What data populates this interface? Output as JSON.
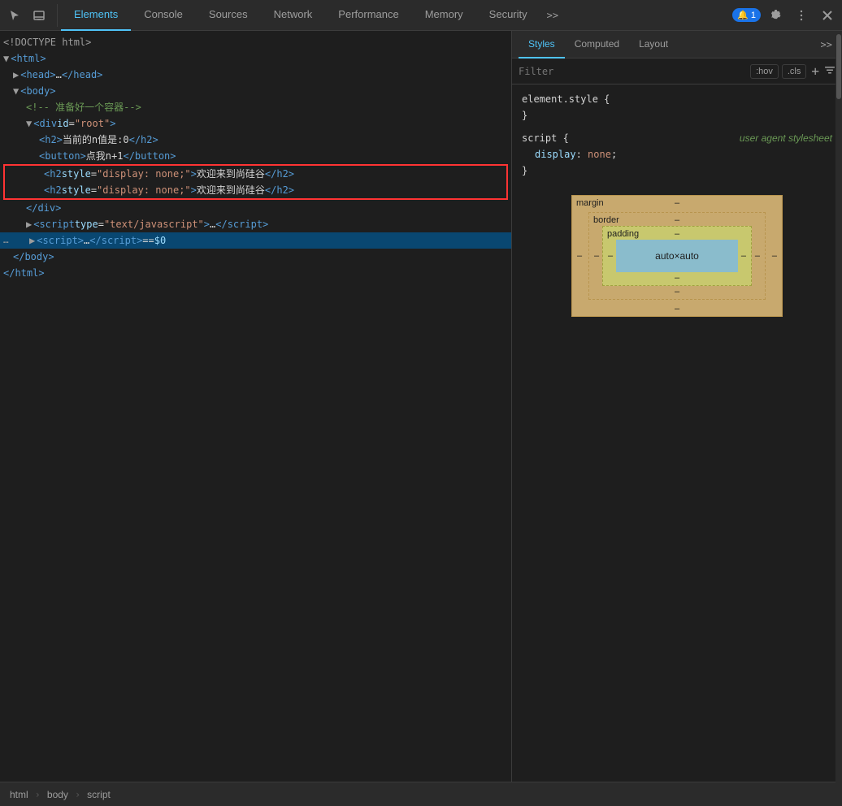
{
  "toolbar": {
    "icons": [
      {
        "name": "cursor-icon",
        "symbol": "⊡"
      },
      {
        "name": "device-icon",
        "symbol": "⬜"
      }
    ],
    "tabs": [
      {
        "id": "elements",
        "label": "Elements",
        "active": true
      },
      {
        "id": "console",
        "label": "Console",
        "active": false
      },
      {
        "id": "sources",
        "label": "Sources",
        "active": false
      },
      {
        "id": "network",
        "label": "Network",
        "active": false
      },
      {
        "id": "performance",
        "label": "Performance",
        "active": false
      },
      {
        "id": "memory",
        "label": "Memory",
        "active": false
      },
      {
        "id": "security",
        "label": "Security",
        "active": false
      }
    ],
    "badge_count": "1",
    "more_tabs": ">>"
  },
  "dom_tree": {
    "lines": [
      {
        "id": "line1",
        "indent": 0,
        "content": "<!DOCTYPE html>",
        "type": "doctype"
      },
      {
        "id": "line2",
        "indent": 0,
        "content_html": "<span class='tag'>&lt;html&gt;</span>"
      },
      {
        "id": "line3",
        "indent": 1,
        "content_html": "<span class='expand-arrow'>▶</span> <span class='tag'>&lt;head&gt;</span><span class='text-content'>…</span><span class='tag'>&lt;/head&gt;</span>"
      },
      {
        "id": "line4",
        "indent": 0,
        "content_html": "<span class='expand-arrow'>▼</span> <span class='tag'>&lt;body&gt;</span>"
      },
      {
        "id": "line5",
        "indent": 2,
        "content_html": "<span class='comment'>&lt;!-- 准备好一个容器--&gt;</span>"
      },
      {
        "id": "line6",
        "indent": 2,
        "content_html": "<span class='expand-arrow'>▼</span> <span class='tag'>&lt;div</span> <span class='attr-name'>id</span>=<span class='attr-value'>\"root\"</span><span class='tag'>&gt;</span>"
      },
      {
        "id": "line7",
        "indent": 3,
        "content_html": "<span class='tag'>&lt;h2&gt;</span><span class='text-content'>当前的n值是:0</span><span class='tag'>&lt;/h2&gt;</span>"
      },
      {
        "id": "line8",
        "indent": 3,
        "content_html": "<span class='tag'>&lt;button&gt;</span><span class='text-content'>点我n+1</span><span class='tag'>&lt;/button&gt;</span>"
      },
      {
        "id": "line9",
        "indent": 3,
        "content_html": "<span class='tag'>&lt;h2</span> <span class='attr-name'>style</span>=<span class='attr-value'>\"display: none;\"</span><span class='tag'>&gt;</span><span class='text-content'>欢迎来到尚硅谷</span><span class='tag'>&lt;/h2&gt;</span>",
        "highlight": true
      },
      {
        "id": "line10",
        "indent": 3,
        "content_html": "<span class='tag'>&lt;h2</span> <span class='attr-name'>style</span>=<span class='attr-value'>\"display: none;\"</span><span class='tag'>&gt;</span><span class='text-content'>欢迎来到尚硅谷</span><span class='tag'>&lt;/h2&gt;</span>",
        "highlight": true
      },
      {
        "id": "line11",
        "indent": 2,
        "content_html": "<span class='tag'>&lt;/div&gt;</span>"
      },
      {
        "id": "line12",
        "indent": 2,
        "content_html": "<span class='expand-arrow'>▶</span> <span class='tag'>&lt;script</span> <span class='attr-name'>type</span>=<span class='attr-value'>\"text/javascript\"</span><span class='tag'>&gt;</span><span class='text-content'>…</span><span class='tag'>&lt;/script&gt;</span>"
      },
      {
        "id": "line13",
        "indent": 2,
        "content_html": "<span class='expand-arrow'>▶</span> <span class='tag'>&lt;script&gt;</span><span class='text-content'>…</span><span class='tag'>&lt;/script&gt;</span> == <span style='color:#9cdcfe'>$0</span>",
        "selected": true
      },
      {
        "id": "line14",
        "indent": 0,
        "content_html": "<span class='tag'>&lt;/body&gt;</span>"
      },
      {
        "id": "line15",
        "indent": 0,
        "content_html": "<span class='tag'>&lt;/html&gt;</span>"
      }
    ]
  },
  "styles_panel": {
    "tabs": [
      {
        "id": "styles",
        "label": "Styles",
        "active": true
      },
      {
        "id": "computed",
        "label": "Computed",
        "active": false
      },
      {
        "id": "layout",
        "label": "Layout",
        "active": false
      }
    ],
    "more_tabs": ">>",
    "filter_placeholder": "Filter",
    "filter_hov": ":hov",
    "filter_cls": ".cls",
    "rules": [
      {
        "selector": "element.style {",
        "close": "}",
        "properties": []
      },
      {
        "selector": "script {",
        "source": "user agent stylesheet",
        "close": "}",
        "properties": [
          {
            "property": "display",
            "value": "none",
            "colon": ":"
          }
        ]
      }
    ],
    "box_model": {
      "margin_label": "margin",
      "border_label": "border",
      "padding_label": "padding",
      "content_label": "auto×auto",
      "margin_dash": "–",
      "border_dash": "–",
      "padding_dash": "–",
      "top_dash": "–",
      "right_dash": "–",
      "bottom_dash": "–",
      "left_dash": "–",
      "content_bottom": "–"
    }
  },
  "breadcrumb": {
    "items": [
      "html",
      "body",
      "script"
    ]
  }
}
